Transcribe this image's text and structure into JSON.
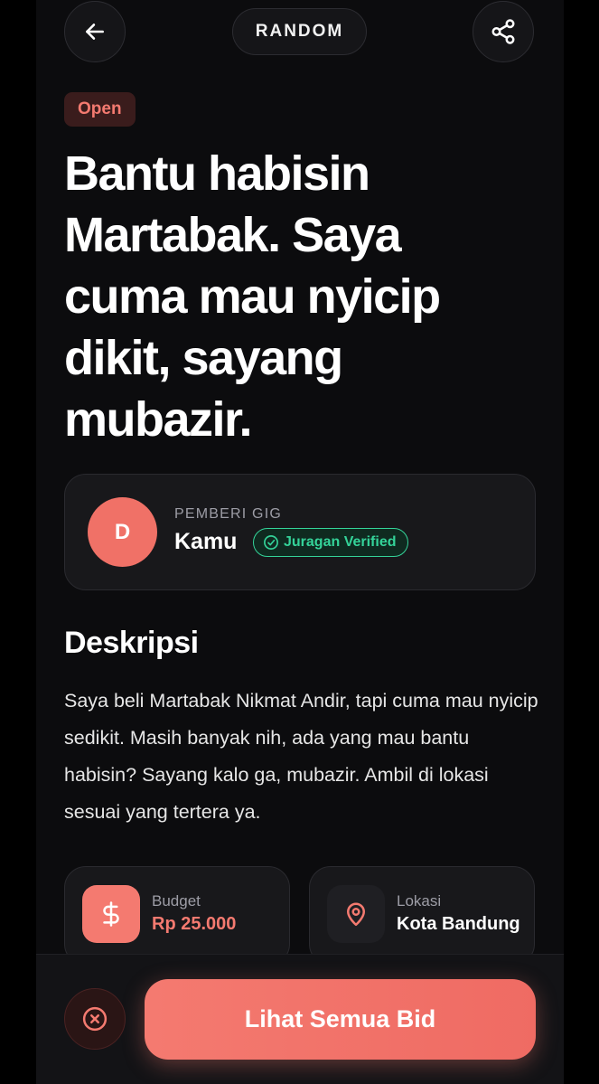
{
  "header": {
    "mode_label": "RANDOM",
    "back_icon": "arrow-left-icon",
    "share_icon": "share-icon"
  },
  "gig": {
    "status": "Open",
    "title": "Bantu habisin Martabak. Saya cuma mau nyicip dikit, sayang mubazir."
  },
  "owner": {
    "role_label": "PEMBERI GIG",
    "avatar_initial": "D",
    "name": "Kamu",
    "verified_label": "Juragan Verified",
    "verified_icon": "check-circle-icon"
  },
  "description": {
    "heading": "Deskripsi",
    "text": "Saya beli Martabak Nikmat Andir, tapi cuma mau nyicip sedikit. Masih banyak nih, ada yang mau bantu habisin? Sayang kalo ga, mubazir. Ambil di lokasi sesuai yang tertera ya."
  },
  "budget": {
    "label": "Budget",
    "value": "Rp 25.000",
    "icon": "dollar-icon"
  },
  "location": {
    "label": "Lokasi",
    "value": "Kota Bandung",
    "icon": "map-pin-icon"
  },
  "actions": {
    "cancel_icon": "close-circle-icon",
    "cta_label": "Lihat Semua Bid"
  },
  "colors": {
    "accent": "#f47a70",
    "verified": "#34d399",
    "background": "#0c0c0e",
    "card": "#18181b"
  }
}
